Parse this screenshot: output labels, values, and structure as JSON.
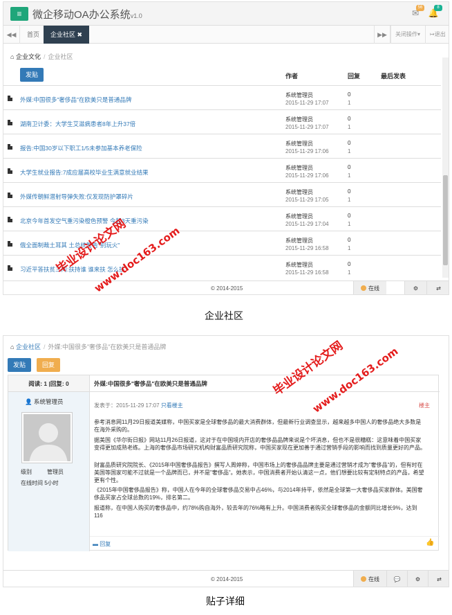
{
  "app": {
    "title": "微企移动OA办公系统",
    "version": "v1.0",
    "mail_badge": "56",
    "bell_badge": "8",
    "colors": {
      "sidebar_dark": "#2f4050",
      "accent_green": "#1fa67a",
      "primary": "#337ab7",
      "warning": "#f0ad4e",
      "badge_orange": "#f0ad4e",
      "badge_green": "#1ab394",
      "watermark_red": "#e31010"
    }
  },
  "tabs": {
    "home": "首页",
    "community": "企业社区",
    "close_ops": "关闭操作",
    "logout": "退出"
  },
  "list_page": {
    "breadcrumb_root": "企业文化",
    "breadcrumb_current": "企业社区",
    "post_button": "发贴",
    "col_author": "作者",
    "col_reply": "回复",
    "col_last": "最后发表",
    "posts": [
      {
        "title": "外媒:中国很多\"奢侈品\"在欧美只是普通品牌",
        "author": "系统管理员",
        "time": "2015-11-29 17:07",
        "replies": "0",
        "views": "1"
      },
      {
        "title": "湖南卫计委：大学生艾滋病患者8年上升37倍",
        "author": "系统管理员",
        "time": "2015-11-29 17:07",
        "replies": "0",
        "views": "1"
      },
      {
        "title": "报告:中国30岁以下职工1/5未参加基本养老保险",
        "author": "系统管理员",
        "time": "2015-11-29 17:06",
        "replies": "0",
        "views": "1"
      },
      {
        "title": "大学生就业报告:7成应届高校毕业生满意就业结果",
        "author": "系统管理员",
        "time": "2015-11-29 17:06",
        "replies": "0",
        "views": "1"
      },
      {
        "title": "外媒传朝鲜潜射导弹失败:仅发现防护罩碎片",
        "author": "系统管理员",
        "time": "2015-11-29 17:05",
        "replies": "0",
        "views": "1"
      },
      {
        "title": "北京今年首发空气重污染橙色预警 今起3天重污染",
        "author": "系统管理员",
        "time": "2015-11-29 17:04",
        "replies": "0",
        "views": "1"
      },
      {
        "title": "俄全面制裁土耳其 土总统警告\"别玩火\"",
        "author": "系统管理员",
        "time": "2015-11-29 16:58",
        "replies": "0",
        "views": "1"
      },
      {
        "title": "习近平答扶贫三问:扶持谁 谁来扶 怎么扶",
        "author": "系统管理员",
        "time": "2015-11-29 16:58",
        "replies": "0",
        "views": "1"
      }
    ]
  },
  "footer": {
    "copyright": "© 2014-2015",
    "online": "在线"
  },
  "captions": {
    "first": "企业社区",
    "second": "贴子详细"
  },
  "watermark": {
    "line1": "毕业设计论文网",
    "line2": "www.doc163.com"
  },
  "detail_page": {
    "breadcrumb_root": "企业社区",
    "breadcrumb_current": "外媒:中国很多\"奢侈品\"在欧美只是普通品牌",
    "post_button": "发贴",
    "reply_button": "回复",
    "stats": "阅读: 1 |回复: 0",
    "post_title": "外媒:中国很多\"奢侈品\"在欧美只是普通品牌",
    "author_name": "系统管理员",
    "level_label": "级别",
    "level_value": "管理员",
    "online_time": "在线时间 5小时",
    "posted_at": "发表于：2015-11-29 17:07",
    "only_owner": "只看楼主",
    "owner_tag": "楼主",
    "paragraphs": [
      "参考消息网11月29日报道美媒称，中国买家是全球奢侈品的最大消费群体，但最新行业调查显示，越来越多中国人的奢侈品绝大多数是在海外采购的。",
      "据美国《华尔街日报》网站11月26日报道，这对于在中国境内开店的奢侈品品牌来说是个坏消息，但也不是很糟糕：这意味着中国买家变得更加成熟老练。上海的奢侈品市场研究机构财富品质研究院称，中国买家现在更加善于通过营销手段的影响而找到质量更好的产品。",
      "财富品质研究院院长、《2015年中国奢侈品报告》撰写人周婷称，中国市场上的奢侈品品牌主要是通过营销才成为\"奢侈品\"的，但有时在美国等国家可能不过就是一个品牌而已，并不是\"奢侈品\"。她表示，中国消费者开始认清这一点，他们想要比较有定制特点的产品，希望更有个性。",
      "《2015年中国奢侈品报告》称，中国人在今年的全球奢侈品交易中占46%，与2014年持平，依然是全球第一大奢侈品买家群体。美国奢侈品买家占全球总数的19%，排名第二。",
      "报道称，在中国人购买的奢侈品中，约78%购自海外，较去年的76%略有上升。中国消费者购买全球奢侈品的金额同比增长9%，达到116"
    ],
    "reply_link": "回复"
  }
}
